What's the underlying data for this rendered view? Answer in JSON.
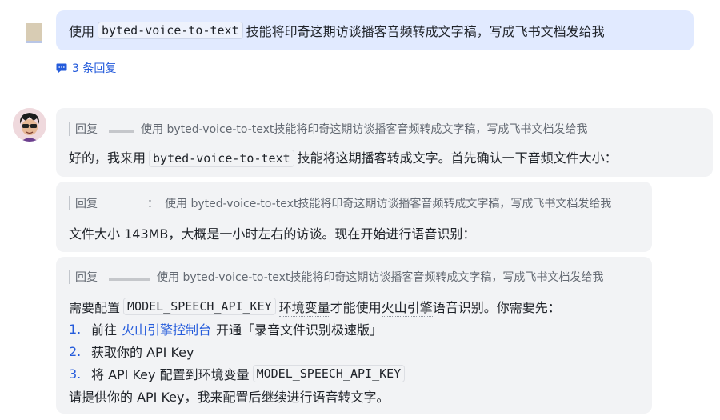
{
  "user_message": {
    "prefix": "使用",
    "code": "byted-voice-to-text",
    "suffix": "技能将印奇这期访谈播客音频转成文字稿，写成飞书文档发给我"
  },
  "thread": {
    "reply_count": "3 条回复"
  },
  "bot_messages": [
    {
      "quote_label": "回复",
      "quote_text": "使用 byted-voice-to-text技能将印奇这期访谈播客音频转成文字稿，写成飞书文档发给我",
      "text_before": "好的，我来用",
      "code": "byted-voice-to-text",
      "text_after": "技能将这期播客转成文字。首先确认一下音频文件大小："
    },
    {
      "quote_label": "回复",
      "quote_colon": "：",
      "quote_text": "使用 byted-voice-to-text技能将印奇这期访谈播客音频转成文字稿，写成飞书文档发给我",
      "text": "文件大小 143MB，大概是一小时左右的访谈。现在开始进行语音识别："
    },
    {
      "quote_label": "回复",
      "quote_text": "使用 byted-voice-to-text技能将印奇这期访谈播客音频转成文字稿，写成飞书文档发给我",
      "line1_before": "需要配置",
      "line1_code": "MODEL_SPEECH_API_KEY",
      "line1_mid": "环境变量",
      "line1_mid2": "才能使用",
      "line1_link": "火山引擎",
      "line1_after": "语音识别。你需要先：",
      "steps": [
        {
          "num": "1.",
          "before": "前往",
          "link": "火山引擎控制台",
          "after": "开通「录音文件识别极速版」"
        },
        {
          "num": "2.",
          "text": "获取你的 API Key"
        },
        {
          "num": "3.",
          "before": "将 API Key 配置到环境变量",
          "code": "MODEL_SPEECH_API_KEY"
        }
      ],
      "closing": "请提供你的 API Key，我来配置后继续进行语音转文字。"
    }
  ]
}
